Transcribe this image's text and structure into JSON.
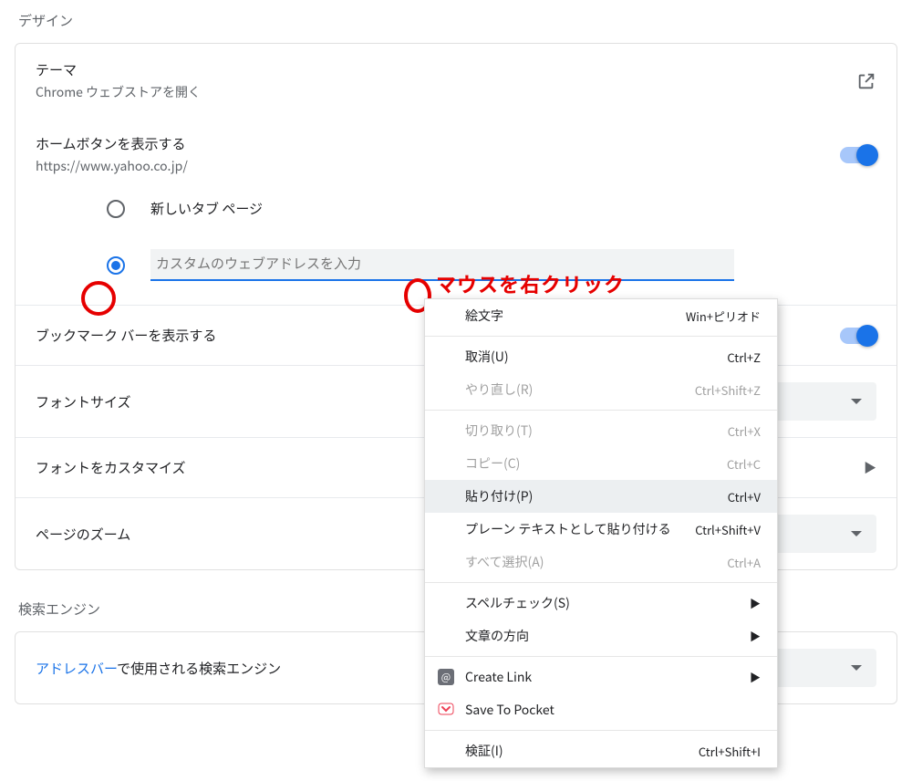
{
  "section_design": "デザイン",
  "theme": {
    "title": "テーマ",
    "sub": "Chrome ウェブストアを開く"
  },
  "home": {
    "title": "ホームボタンを表示する",
    "url": "https://www.yahoo.co.jp/"
  },
  "radio": {
    "new_tab": "新しいタブ ページ",
    "custom_placeholder": "カスタムのウェブアドレスを入力"
  },
  "bookmark": {
    "title": "ブックマーク バーを表示する"
  },
  "font_size": {
    "title": "フォントサイズ"
  },
  "font_custom": {
    "title": "フォントをカスタマイズ"
  },
  "zoom": {
    "title": "ページのズーム"
  },
  "section_search": "検索エンジン",
  "search_row": {
    "prefix": "アドレスバー",
    "suffix": "で使用される検索エンジン"
  },
  "annot_text": "マウスを右クリック",
  "menu": {
    "emoji": {
      "label": "絵文字",
      "sc": "Win+ピリオド"
    },
    "undo": {
      "label": "取消(U)",
      "sc": "Ctrl+Z"
    },
    "redo": {
      "label": "やり直し(R)",
      "sc": "Ctrl+Shift+Z"
    },
    "cut": {
      "label": "切り取り(T)",
      "sc": "Ctrl+X"
    },
    "copy": {
      "label": "コピー(C)",
      "sc": "Ctrl+C"
    },
    "paste": {
      "label": "貼り付け(P)",
      "sc": "Ctrl+V"
    },
    "paste_plain": {
      "label": "プレーン テキストとして貼り付ける",
      "sc": "Ctrl+Shift+V"
    },
    "selall": {
      "label": "すべて選択(A)",
      "sc": "Ctrl+A"
    },
    "spell": {
      "label": "スペルチェック(S)"
    },
    "direction": {
      "label": "文章の方向"
    },
    "create_link": {
      "label": "Create Link"
    },
    "pocket": {
      "label": "Save To Pocket"
    },
    "inspect": {
      "label": "検証(I)",
      "sc": "Ctrl+Shift+I"
    }
  }
}
